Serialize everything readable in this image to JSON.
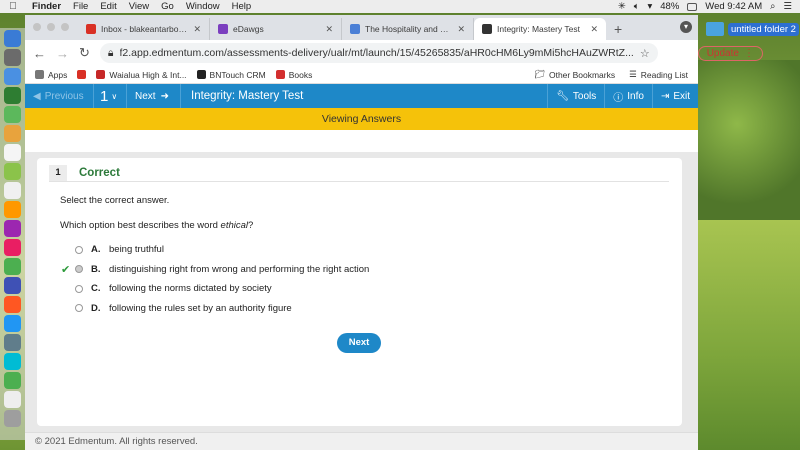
{
  "menubar": {
    "app": "Finder",
    "items": [
      "File",
      "Edit",
      "View",
      "Go",
      "Window",
      "Help"
    ],
    "battery": "48%",
    "clock": "Wed 9:42 AM"
  },
  "desktop": {
    "folder_label": "untitled folder 2"
  },
  "tabs": [
    {
      "title": "Inbox - blakeantarbowman@w",
      "icon_color": "#d93025",
      "icon": "gmail-icon"
    },
    {
      "title": "eDawgs",
      "icon_color": "#7b3fbf",
      "icon": "edawgs-icon"
    },
    {
      "title": "The Hospitality and Tourism In",
      "icon_color": "#4a7fd6",
      "icon": "docs-icon"
    },
    {
      "title": "Integrity: Mastery Test",
      "icon_color": "#333333",
      "icon": "edmentum-icon"
    }
  ],
  "addressbar": {
    "url": "f2.app.edmentum.com/assessments-delivery/ualr/mt/launch/15/45265835/aHR0cHM6Ly9mMi5hcHAuZWRtZ...",
    "update_label": "Update"
  },
  "bookmarks": {
    "items": [
      {
        "label": "Apps",
        "color": "#777777"
      },
      {
        "label": "",
        "color": "#d93025"
      },
      {
        "label": "Waialua High & Int...",
        "color": "#c62828"
      },
      {
        "label": "BNTouch CRM",
        "color": "#222222"
      },
      {
        "label": "Books",
        "color": "#d32f2f"
      }
    ],
    "other": "Other Bookmarks",
    "reading": "Reading List"
  },
  "app": {
    "prev_label": "Previous",
    "question_number": "1",
    "next_label": "Next",
    "title": "Integrity: Mastery Test",
    "tools_label": "Tools",
    "info_label": "Info",
    "exit_label": "Exit",
    "mode_banner": "Viewing Answers"
  },
  "question": {
    "number": "1",
    "status": "Correct",
    "instruction": "Select the correct answer.",
    "prompt_before": "Which option best describes the word ",
    "prompt_em": "ethical",
    "prompt_after": "?",
    "options": [
      {
        "letter": "A.",
        "text": "being truthful",
        "selected": false,
        "correct": false
      },
      {
        "letter": "B.",
        "text": "distinguishing right from wrong and performing the right action",
        "selected": true,
        "correct": true
      },
      {
        "letter": "C.",
        "text": "following the norms dictated by society",
        "selected": false,
        "correct": false
      },
      {
        "letter": "D.",
        "text": "following the rules set by an authority figure",
        "selected": false,
        "correct": false
      }
    ],
    "next_button": "Next"
  },
  "footer": {
    "copyright": "© 2021 Edmentum. All rights reserved."
  }
}
